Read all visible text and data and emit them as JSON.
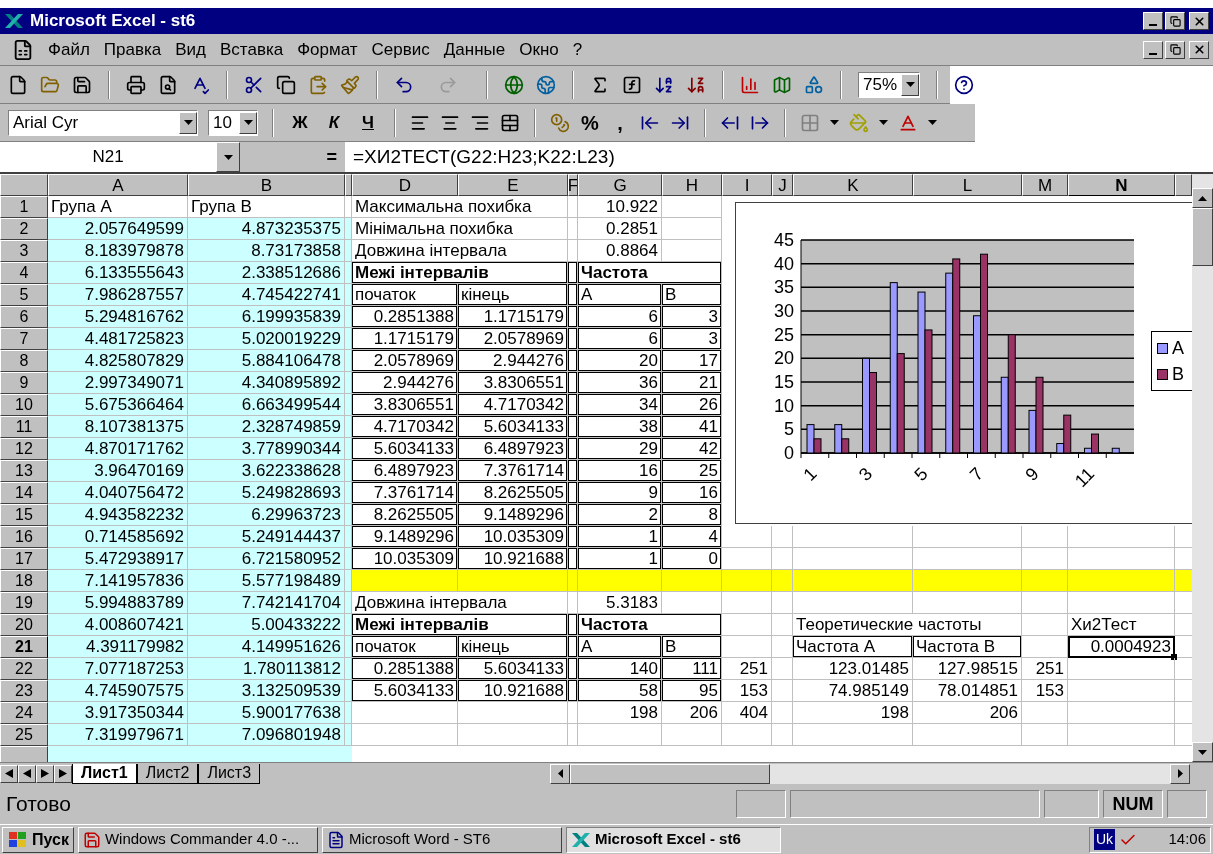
{
  "window": {
    "title": "Microsoft Excel - st6"
  },
  "menu": [
    "Файл",
    "Правка",
    "Вид",
    "Вставка",
    "Формат",
    "Сервис",
    "Данные",
    "Окно",
    "?"
  ],
  "toolbar": {
    "zoom": "75%"
  },
  "formatting": {
    "font": "Arial Cyr",
    "size": "10",
    "style_buttons": [
      "Ж",
      "К",
      "Ч"
    ],
    "number_buttons": [
      "%",
      ","
    ]
  },
  "formula_bar": {
    "cell": "N21",
    "equals": "=",
    "formula": "=ХИ2ТЕСТ(G22:H23;K22:L23)"
  },
  "columns": [
    {
      "label": "A",
      "selected": false
    },
    {
      "label": "B",
      "selected": false
    },
    {
      "selected": false
    },
    {
      "label": "D",
      "selected": false
    },
    {
      "label": "E",
      "selected": false
    },
    {
      "label": "F",
      "selected": false
    },
    {
      "label": "G",
      "selected": false
    },
    {
      "label": "H",
      "selected": false
    },
    {
      "label": "I",
      "selected": false
    },
    {
      "label": "J",
      "selected": false
    },
    {
      "label": "K",
      "selected": false
    },
    {
      "label": "L",
      "selected": false
    },
    {
      "label": "M",
      "selected": false
    },
    {
      "label": "N",
      "selected": true
    }
  ],
  "rows": [
    {
      "label": "1",
      "selected": false,
      "cells": {
        "A": {
          "text": "Група А",
          "kind": "text"
        },
        "B": {
          "text": "Група В",
          "kind": "text"
        },
        "D": {
          "text": "Максимальна похибка",
          "kind": "label"
        },
        "G": {
          "text": "10.922",
          "kind": "number"
        }
      }
    },
    {
      "label": "2",
      "selected": false,
      "cells": {
        "A": {
          "text": "2.057649599",
          "kind": "number",
          "color": "#ccffff"
        },
        "B": {
          "text": "4.873235375",
          "kind": "number",
          "color": "#ccffff"
        },
        "C": {
          "color": "#ccffff"
        },
        "D": {
          "text": "Мінімальна похибка",
          "kind": "label"
        },
        "G": {
          "text": "0.2851",
          "kind": "number"
        }
      }
    },
    {
      "label": "3",
      "selected": false,
      "cells": {
        "A": {
          "text": "8.183979878",
          "kind": "number",
          "color": "#ccffff"
        },
        "B": {
          "text": "8.73173858",
          "kind": "number",
          "color": "#ccffff"
        },
        "C": {
          "color": "#ccffff"
        },
        "D": {
          "text": "Довжина інтервала",
          "kind": "label"
        },
        "G": {
          "text": "0.8864",
          "kind": "number"
        }
      }
    },
    {
      "label": "4",
      "selected": false,
      "cells": {
        "A": {
          "text": "6.133555643",
          "kind": "number",
          "color": "#ccffff"
        },
        "B": {
          "text": "2.338512686",
          "kind": "number",
          "color": "#ccffff"
        },
        "C": {
          "color": "#ccffff"
        },
        "D": {
          "text": "Межі інтервалів",
          "kind": "heading",
          "boxed": true
        },
        "F": {
          "boxed": true
        },
        "G": {
          "text": "Частота",
          "kind": "heading",
          "boxed": true
        }
      }
    },
    {
      "label": "5",
      "selected": false,
      "cells": {
        "A": {
          "text": "7.986287557",
          "kind": "number",
          "color": "#ccffff"
        },
        "B": {
          "text": "4.745422741",
          "kind": "number",
          "color": "#ccffff"
        },
        "C": {
          "color": "#ccffff"
        },
        "D": {
          "text": "початок",
          "kind": "text",
          "boxed": true
        },
        "E": {
          "text": "кінець",
          "kind": "text",
          "boxed": true
        },
        "F": {
          "boxed": true
        },
        "G": {
          "text": "А",
          "kind": "text",
          "boxed": true
        },
        "H": {
          "text": "В",
          "kind": "text",
          "boxed": true
        }
      }
    },
    {
      "label": "6",
      "selected": false,
      "cells": {
        "A": {
          "text": "5.294816762",
          "kind": "number",
          "color": "#ccffff"
        },
        "B": {
          "text": "6.199935839",
          "kind": "number",
          "color": "#ccffff"
        },
        "C": {
          "color": "#ccffff"
        },
        "D": {
          "text": "0.2851388",
          "kind": "number",
          "boxed": true
        },
        "E": {
          "text": "1.1715179",
          "kind": "number",
          "boxed": true
        },
        "F": {
          "boxed": true
        },
        "G": {
          "text": "6",
          "kind": "number",
          "boxed": true
        },
        "H": {
          "text": "3",
          "kind": "number",
          "boxed": true
        }
      }
    },
    {
      "label": "7",
      "selected": false,
      "cells": {
        "A": {
          "text": "4.481725823",
          "kind": "number",
          "color": "#ccffff"
        },
        "B": {
          "text": "5.020019229",
          "kind": "number",
          "color": "#ccffff"
        },
        "C": {
          "color": "#ccffff"
        },
        "D": {
          "text": "1.1715179",
          "kind": "number",
          "boxed": true
        },
        "E": {
          "text": "2.0578969",
          "kind": "number",
          "boxed": true
        },
        "F": {
          "boxed": true
        },
        "G": {
          "text": "6",
          "kind": "number",
          "boxed": true
        },
        "H": {
          "text": "3",
          "kind": "number",
          "boxed": true
        }
      }
    },
    {
      "label": "8",
      "selected": false,
      "cells": {
        "A": {
          "text": "4.825807829",
          "kind": "number",
          "color": "#ccffff"
        },
        "B": {
          "text": "5.884106478",
          "kind": "number",
          "color": "#ccffff"
        },
        "C": {
          "color": "#ccffff"
        },
        "D": {
          "text": "2.0578969",
          "kind": "number",
          "boxed": true
        },
        "E": {
          "text": "2.944276",
          "kind": "number",
          "boxed": true
        },
        "F": {
          "boxed": true
        },
        "G": {
          "text": "20",
          "kind": "number",
          "boxed": true
        },
        "H": {
          "text": "17",
          "kind": "number",
          "boxed": true
        }
      }
    },
    {
      "label": "9",
      "selected": false,
      "cells": {
        "A": {
          "text": "2.997349071",
          "kind": "number",
          "color": "#ccffff"
        },
        "B": {
          "text": "4.340895892",
          "kind": "number",
          "color": "#ccffff"
        },
        "C": {
          "color": "#ccffff"
        },
        "D": {
          "text": "2.944276",
          "kind": "number",
          "boxed": true
        },
        "E": {
          "text": "3.8306551",
          "kind": "number",
          "boxed": true
        },
        "F": {
          "boxed": true
        },
        "G": {
          "text": "36",
          "kind": "number",
          "boxed": true
        },
        "H": {
          "text": "21",
          "kind": "number",
          "boxed": true
        }
      }
    },
    {
      "label": "10",
      "selected": false,
      "cells": {
        "A": {
          "text": "5.675366464",
          "kind": "number",
          "color": "#ccffff"
        },
        "B": {
          "text": "6.663499544",
          "kind": "number",
          "color": "#ccffff"
        },
        "C": {
          "color": "#ccffff"
        },
        "D": {
          "text": "3.8306551",
          "kind": "number",
          "boxed": true
        },
        "E": {
          "text": "4.7170342",
          "kind": "number",
          "boxed": true
        },
        "F": {
          "boxed": true
        },
        "G": {
          "text": "34",
          "kind": "number",
          "boxed": true
        },
        "H": {
          "text": "26",
          "kind": "number",
          "boxed": true
        }
      }
    },
    {
      "label": "11",
      "selected": false,
      "cells": {
        "A": {
          "text": "8.107381375",
          "kind": "number",
          "color": "#ccffff"
        },
        "B": {
          "text": "2.328749859",
          "kind": "number",
          "color": "#ccffff"
        },
        "C": {
          "color": "#ccffff"
        },
        "D": {
          "text": "4.7170342",
          "kind": "number",
          "boxed": true
        },
        "E": {
          "text": "5.6034133",
          "kind": "number",
          "boxed": true
        },
        "F": {
          "boxed": true
        },
        "G": {
          "text": "38",
          "kind": "number",
          "boxed": true
        },
        "H": {
          "text": "41",
          "kind": "number",
          "boxed": true
        }
      }
    },
    {
      "label": "12",
      "selected": false,
      "cells": {
        "A": {
          "text": "4.870171762",
          "kind": "number",
          "color": "#ccffff"
        },
        "B": {
          "text": "3.778990344",
          "kind": "number",
          "color": "#ccffff"
        },
        "C": {
          "color": "#ccffff"
        },
        "D": {
          "text": "5.6034133",
          "kind": "number",
          "boxed": true
        },
        "E": {
          "text": "6.4897923",
          "kind": "number",
          "boxed": true
        },
        "F": {
          "boxed": true
        },
        "G": {
          "text": "29",
          "kind": "number",
          "boxed": true
        },
        "H": {
          "text": "42",
          "kind": "number",
          "boxed": true
        }
      }
    },
    {
      "label": "13",
      "selected": false,
      "cells": {
        "A": {
          "text": "3.96470169",
          "kind": "number",
          "color": "#ccffff"
        },
        "B": {
          "text": "3.622338628",
          "kind": "number",
          "color": "#ccffff"
        },
        "C": {
          "color": "#ccffff"
        },
        "D": {
          "text": "6.4897923",
          "kind": "number",
          "boxed": true
        },
        "E": {
          "text": "7.3761714",
          "kind": "number",
          "boxed": true
        },
        "F": {
          "boxed": true
        },
        "G": {
          "text": "16",
          "kind": "number",
          "boxed": true
        },
        "H": {
          "text": "25",
          "kind": "number",
          "boxed": true
        }
      }
    },
    {
      "label": "14",
      "selected": false,
      "cells": {
        "A": {
          "text": "4.040756472",
          "kind": "number",
          "color": "#ccffff"
        },
        "B": {
          "text": "5.249828693",
          "kind": "number",
          "color": "#ccffff"
        },
        "C": {
          "color": "#ccffff"
        },
        "D": {
          "text": "7.3761714",
          "kind": "number",
          "boxed": true
        },
        "E": {
          "text": "8.2625505",
          "kind": "number",
          "boxed": true
        },
        "F": {
          "boxed": true
        },
        "G": {
          "text": "9",
          "kind": "number",
          "boxed": true
        },
        "H": {
          "text": "16",
          "kind": "number",
          "boxed": true
        }
      }
    },
    {
      "label": "15",
      "selected": false,
      "cells": {
        "A": {
          "text": "4.943582232",
          "kind": "number",
          "color": "#ccffff"
        },
        "B": {
          "text": "6.29963723",
          "kind": "number",
          "color": "#ccffff"
        },
        "C": {
          "color": "#ccffff"
        },
        "D": {
          "text": "8.2625505",
          "kind": "number",
          "boxed": true
        },
        "E": {
          "text": "9.1489296",
          "kind": "number",
          "boxed": true
        },
        "F": {
          "boxed": true
        },
        "G": {
          "text": "2",
          "kind": "number",
          "boxed": true
        },
        "H": {
          "text": "8",
          "kind": "number",
          "boxed": true
        }
      }
    },
    {
      "label": "16",
      "selected": false,
      "cells": {
        "A": {
          "text": "0.714585692",
          "kind": "number",
          "color": "#ccffff"
        },
        "B": {
          "text": "5.249144437",
          "kind": "number",
          "color": "#ccffff"
        },
        "C": {
          "color": "#ccffff"
        },
        "D": {
          "text": "9.1489296",
          "kind": "number",
          "boxed": true
        },
        "E": {
          "text": "10.035309",
          "kind": "number",
          "boxed": true
        },
        "F": {
          "boxed": true
        },
        "G": {
          "text": "1",
          "kind": "number",
          "boxed": true
        },
        "H": {
          "text": "4",
          "kind": "number",
          "boxed": true
        }
      }
    },
    {
      "label": "17",
      "selected": false,
      "cells": {
        "A": {
          "text": "5.472938917",
          "kind": "number",
          "color": "#ccffff"
        },
        "B": {
          "text": "6.721580952",
          "kind": "number",
          "color": "#ccffff"
        },
        "C": {
          "color": "#ccffff"
        },
        "D": {
          "text": "10.035309",
          "kind": "number",
          "boxed": true
        },
        "E": {
          "text": "10.921688",
          "kind": "number",
          "boxed": true
        },
        "F": {
          "boxed": true
        },
        "G": {
          "text": "1",
          "kind": "number",
          "boxed": true
        },
        "H": {
          "text": "0",
          "kind": "number",
          "boxed": true
        }
      }
    },
    {
      "label": "18",
      "selected": false,
      "cells": {
        "A": {
          "text": "7.141957836",
          "kind": "number",
          "color": "#ccffff"
        },
        "B": {
          "text": "5.577198489",
          "kind": "number",
          "color": "#ccffff"
        },
        "C": {
          "color": "#ccffff"
        },
        "D": {
          "color": "#ffff00"
        },
        "E": {
          "color": "#ffff00"
        },
        "F": {
          "color": "#ffff00"
        },
        "G": {
          "color": "#ffff00"
        },
        "H": {
          "color": "#ffff00"
        },
        "I": {
          "color": "#ffff00"
        },
        "J": {
          "color": "#ffff00"
        },
        "K": {
          "color": "#ffff00"
        },
        "L": {
          "color": "#ffff00"
        },
        "M": {
          "color": "#ffff00"
        },
        "N": {
          "color": "#ffff00"
        },
        "O": {
          "color": "#ffff00"
        }
      }
    },
    {
      "label": "19",
      "selected": false,
      "cells": {
        "A": {
          "text": "5.994883789",
          "kind": "number",
          "color": "#ccffff"
        },
        "B": {
          "text": "7.742141704",
          "kind": "number",
          "color": "#ccffff"
        },
        "C": {
          "color": "#ccffff"
        },
        "D": {
          "text": "Довжина інтервала",
          "kind": "label"
        },
        "G": {
          "text": "5.3183",
          "kind": "number"
        }
      }
    },
    {
      "label": "20",
      "selected": false,
      "cells": {
        "A": {
          "text": "4.008607421",
          "kind": "number",
          "color": "#ccffff"
        },
        "B": {
          "text": "5.00433222",
          "kind": "number",
          "color": "#ccffff"
        },
        "C": {
          "color": "#ccffff"
        },
        "D": {
          "text": "Межі інтервалів",
          "kind": "heading",
          "boxed": true
        },
        "F": {
          "boxed": true
        },
        "G": {
          "text": "Частота",
          "kind": "heading",
          "boxed": true
        },
        "K": {
          "text": "Теоретические частоты",
          "kind": "label"
        },
        "N": {
          "text": "Хи2Тест",
          "kind": "text"
        }
      }
    },
    {
      "label": "21",
      "selected": true,
      "cells": {
        "A": {
          "text": "4.391179982",
          "kind": "number",
          "color": "#ccffff"
        },
        "B": {
          "text": "4.149951626",
          "kind": "number",
          "color": "#ccffff"
        },
        "C": {
          "color": "#ccffff"
        },
        "D": {
          "text": "початок",
          "kind": "text",
          "boxed": true
        },
        "E": {
          "text": "кінець",
          "kind": "text",
          "boxed": true
        },
        "F": {
          "boxed": true
        },
        "G": {
          "text": "А",
          "kind": "text",
          "boxed": true
        },
        "H": {
          "text": "В",
          "kind": "text",
          "boxed": true
        },
        "K": {
          "text": "Частота А",
          "kind": "text",
          "boxed": true
        },
        "L": {
          "text": "Частота В",
          "kind": "text",
          "boxed": true
        },
        "N": {
          "text": "0.0004923",
          "kind": "number",
          "selected": true
        }
      }
    },
    {
      "label": "22",
      "selected": false,
      "cells": {
        "A": {
          "text": "7.077187253",
          "kind": "number",
          "color": "#ccffff"
        },
        "B": {
          "text": "1.780113812",
          "kind": "number",
          "color": "#ccffff"
        },
        "C": {
          "color": "#ccffff"
        },
        "D": {
          "text": "0.2851388",
          "kind": "number",
          "boxed": true
        },
        "E": {
          "text": "5.6034133",
          "kind": "number",
          "boxed": true
        },
        "F": {
          "boxed": true
        },
        "G": {
          "text": "140",
          "kind": "number",
          "boxed": true
        },
        "H": {
          "text": "111",
          "kind": "number",
          "boxed": true
        },
        "I": {
          "text": "251",
          "kind": "number"
        },
        "K": {
          "text": "123.01485",
          "kind": "number"
        },
        "L": {
          "text": "127.98515",
          "kind": "number"
        },
        "M": {
          "text": "251",
          "kind": "number"
        }
      }
    },
    {
      "label": "23",
      "selected": false,
      "cells": {
        "A": {
          "text": "4.745907575",
          "kind": "number",
          "color": "#ccffff"
        },
        "B": {
          "text": "3.132509539",
          "kind": "number",
          "color": "#ccffff"
        },
        "C": {
          "color": "#ccffff"
        },
        "D": {
          "text": "5.6034133",
          "kind": "number",
          "boxed": true
        },
        "E": {
          "text": "10.921688",
          "kind": "number",
          "boxed": true
        },
        "F": {
          "boxed": true
        },
        "G": {
          "text": "58",
          "kind": "number",
          "boxed": true
        },
        "H": {
          "text": "95",
          "kind": "number",
          "boxed": true
        },
        "I": {
          "text": "153",
          "kind": "number"
        },
        "K": {
          "text": "74.985149",
          "kind": "number"
        },
        "L": {
          "text": "78.014851",
          "kind": "number"
        },
        "M": {
          "text": "153",
          "kind": "number"
        }
      }
    },
    {
      "label": "24",
      "selected": false,
      "cells": {
        "A": {
          "text": "3.917350344",
          "kind": "number",
          "color": "#ccffff"
        },
        "B": {
          "text": "5.900177638",
          "kind": "number",
          "color": "#ccffff"
        },
        "C": {
          "color": "#ccffff"
        },
        "G": {
          "text": "198",
          "kind": "number"
        },
        "H": {
          "text": "206",
          "kind": "number"
        },
        "I": {
          "text": "404",
          "kind": "number"
        },
        "K": {
          "text": "198",
          "kind": "number"
        },
        "L": {
          "text": "206",
          "kind": "number"
        }
      }
    },
    {
      "label": "25",
      "selected": false,
      "cells": {
        "A": {
          "text": "7.319979671",
          "kind": "number",
          "color": "#ccffff"
        },
        "B": {
          "text": "7.096801948",
          "kind": "number",
          "color": "#ccffff"
        },
        "C": {
          "color": "#ccffff"
        }
      }
    }
  ],
  "chart": {
    "chart_data": {
      "type": "bar",
      "categories": [
        "1",
        null,
        "3",
        null,
        "5",
        null,
        "7",
        null,
        "9",
        null,
        "11",
        null
      ],
      "ylim": [
        0,
        45
      ],
      "yticks": [
        0,
        5,
        10,
        15,
        20,
        25,
        30,
        35,
        40,
        45
      ],
      "grid": true,
      "legend": true,
      "series": [
        {
          "name": "A",
          "color": "#9999ff",
          "values": [
            6,
            6,
            20,
            36,
            34,
            38,
            29,
            16,
            9,
            2,
            1,
            1
          ]
        },
        {
          "name": "B",
          "color": "#993366",
          "values": [
            3,
            3,
            17,
            21,
            26,
            41,
            42,
            25,
            16,
            8,
            4,
            0
          ]
        }
      ]
    }
  },
  "sheet_tabs": [
    {
      "label": "Лист1",
      "selected": true
    },
    {
      "label": "Лист2",
      "selected": false
    },
    {
      "label": "Лист3",
      "selected": false
    }
  ],
  "status_bar": {
    "text": "Готово",
    "indicator": "NUM"
  },
  "taskbar": {
    "start": "Пуск",
    "tasks": [
      {
        "label": "Windows Commander 4.0 -...",
        "selected": false
      },
      {
        "label": "Microsoft Word - ST6",
        "selected": false
      },
      {
        "label": "Microsoft Excel - st6",
        "selected": true
      }
    ],
    "language": "Uk",
    "clock": "14:06"
  }
}
